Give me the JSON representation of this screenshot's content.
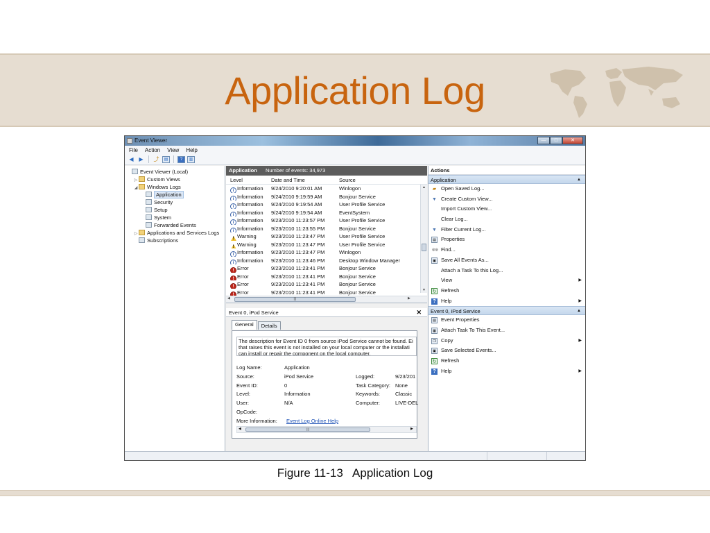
{
  "slide": {
    "title": "Application Log",
    "caption": "Figure 11-13   Application Log"
  },
  "window": {
    "title": "Event Viewer",
    "controls": {
      "minimize": "—",
      "maximize": "□",
      "close": "✕"
    },
    "menu": [
      "File",
      "Action",
      "View",
      "Help"
    ],
    "toolbar_icons": [
      "back-arrow-icon",
      "forward-arrow-icon",
      "up-folder-icon",
      "show-hide-tree-icon",
      "help-icon",
      "show-hide-action-pane-icon"
    ]
  },
  "tree": {
    "items": [
      {
        "label": "Event Viewer (Local)",
        "indent": 0,
        "expander": "",
        "icon": "event-viewer-icon"
      },
      {
        "label": "Custom Views",
        "indent": 1,
        "expander": "▷",
        "icon": "folder-icon"
      },
      {
        "label": "Windows Logs",
        "indent": 1,
        "expander": "◢",
        "icon": "folder-icon"
      },
      {
        "label": "Application",
        "indent": 2,
        "expander": "",
        "icon": "log-icon",
        "selected": true
      },
      {
        "label": "Security",
        "indent": 2,
        "expander": "",
        "icon": "log-icon"
      },
      {
        "label": "Setup",
        "indent": 2,
        "expander": "",
        "icon": "log-icon"
      },
      {
        "label": "System",
        "indent": 2,
        "expander": "",
        "icon": "log-icon"
      },
      {
        "label": "Forwarded Events",
        "indent": 2,
        "expander": "",
        "icon": "log-icon"
      },
      {
        "label": "Applications and Services Logs",
        "indent": 1,
        "expander": "▷",
        "icon": "folder-icon"
      },
      {
        "label": "Subscriptions",
        "indent": 1,
        "expander": "",
        "icon": "subscriptions-icon"
      }
    ]
  },
  "log": {
    "name": "Application",
    "count_text": "Number of events: 34,973",
    "columns": [
      "Level",
      "Date and Time",
      "Source"
    ],
    "rows": [
      {
        "level": "Information",
        "icon": "info",
        "date": "9/24/2010 9:20:01 AM",
        "source": "Winlogon"
      },
      {
        "level": "Information",
        "icon": "info",
        "date": "9/24/2010 9:19:59 AM",
        "source": "Bonjour Service"
      },
      {
        "level": "Information",
        "icon": "info",
        "date": "9/24/2010 9:19:54 AM",
        "source": "User Profile Service"
      },
      {
        "level": "Information",
        "icon": "info",
        "date": "9/24/2010 9:19:54 AM",
        "source": "EventSystem"
      },
      {
        "level": "Information",
        "icon": "info",
        "date": "9/23/2010 11:23:57 PM",
        "source": "User Profile Service"
      },
      {
        "level": "Information",
        "icon": "info",
        "date": "9/23/2010 11:23:55 PM",
        "source": "Bonjour Service"
      },
      {
        "level": "Warning",
        "icon": "warn",
        "date": "9/23/2010 11:23:47 PM",
        "source": "User Profile Service"
      },
      {
        "level": "Warning",
        "icon": "warn",
        "date": "9/23/2010 11:23:47 PM",
        "source": "User Profile Service"
      },
      {
        "level": "Information",
        "icon": "info",
        "date": "9/23/2010 11:23:47 PM",
        "source": "Winlogon"
      },
      {
        "level": "Information",
        "icon": "info",
        "date": "9/23/2010 11:23:46 PM",
        "source": "Desktop Window Manager"
      },
      {
        "level": "Error",
        "icon": "err",
        "date": "9/23/2010 11:23:41 PM",
        "source": "Bonjour Service"
      },
      {
        "level": "Error",
        "icon": "err",
        "date": "9/23/2010 11:23:41 PM",
        "source": "Bonjour Service"
      },
      {
        "level": "Error",
        "icon": "err",
        "date": "9/23/2010 11:23:41 PM",
        "source": "Bonjour Service"
      },
      {
        "level": "Error",
        "icon": "err",
        "date": "9/23/2010 11:23:41 PM",
        "source": "Bonjour Service"
      }
    ]
  },
  "detail": {
    "header": "Event 0, iPod Service",
    "close": "✕",
    "tabs": [
      "General",
      "Details"
    ],
    "description": [
      "The description for Event ID 0 from source iPod Service cannot be found. Ei",
      "that raises this event is not installed on your local computer or the installati",
      "can install or repair the component on the local computer."
    ],
    "left_props": [
      {
        "label": "Log Name:",
        "value": "Application"
      },
      {
        "label": "Source:",
        "value": "iPod Service"
      },
      {
        "label": "Event ID:",
        "value": "0"
      },
      {
        "label": "Level:",
        "value": "Information"
      },
      {
        "label": "User:",
        "value": "N/A"
      },
      {
        "label": "OpCode:",
        "value": ""
      },
      {
        "label": "More Information:",
        "value": "Event Log Online Help"
      }
    ],
    "right_props": [
      {
        "label": "Logged:",
        "value": "9/23/201"
      },
      {
        "label": "Task Category:",
        "value": "None"
      },
      {
        "label": "Keywords:",
        "value": "Classic"
      },
      {
        "label": "Computer:",
        "value": "LIVE-DEL"
      }
    ]
  },
  "actions": {
    "header": "Actions",
    "sections": [
      {
        "title": "Application",
        "items": [
          {
            "label": "Open Saved Log...",
            "icon": "open-folder-icon",
            "submenu": false
          },
          {
            "label": "Create Custom View...",
            "icon": "filter-icon",
            "submenu": false
          },
          {
            "label": "Import Custom View...",
            "icon": "",
            "submenu": false
          },
          {
            "label": "Clear Log...",
            "icon": "",
            "submenu": false
          },
          {
            "label": "Filter Current Log...",
            "icon": "filter-icon",
            "submenu": false
          },
          {
            "label": "Properties",
            "icon": "properties-icon",
            "submenu": false
          },
          {
            "label": "Find...",
            "icon": "binoculars-icon",
            "submenu": false
          },
          {
            "label": "Save All Events As...",
            "icon": "save-icon",
            "submenu": false
          },
          {
            "label": "Attach a Task To this Log...",
            "icon": "",
            "submenu": false
          },
          {
            "label": "View",
            "icon": "",
            "submenu": true
          },
          {
            "label": "Refresh",
            "icon": "refresh-icon",
            "submenu": false
          },
          {
            "label": "Help",
            "icon": "help-icon",
            "submenu": true
          }
        ]
      },
      {
        "title": "Event 0, iPod Service",
        "items": [
          {
            "label": "Event Properties",
            "icon": "properties-icon",
            "submenu": false
          },
          {
            "label": "Attach Task To This Event...",
            "icon": "task-icon",
            "submenu": false
          },
          {
            "label": "Copy",
            "icon": "copy-icon",
            "submenu": true
          },
          {
            "label": "Save Selected Events...",
            "icon": "save-icon",
            "submenu": false
          },
          {
            "label": "Refresh",
            "icon": "refresh-icon",
            "submenu": false
          },
          {
            "label": "Help",
            "icon": "help-icon",
            "submenu": true
          }
        ]
      }
    ]
  },
  "colors": {
    "title": "#c8640f",
    "band": "#e6ddd1",
    "section_header": "#c4d7ec",
    "error": "#c0281c",
    "warning": "#f1c232",
    "info": "#3a62a8"
  }
}
